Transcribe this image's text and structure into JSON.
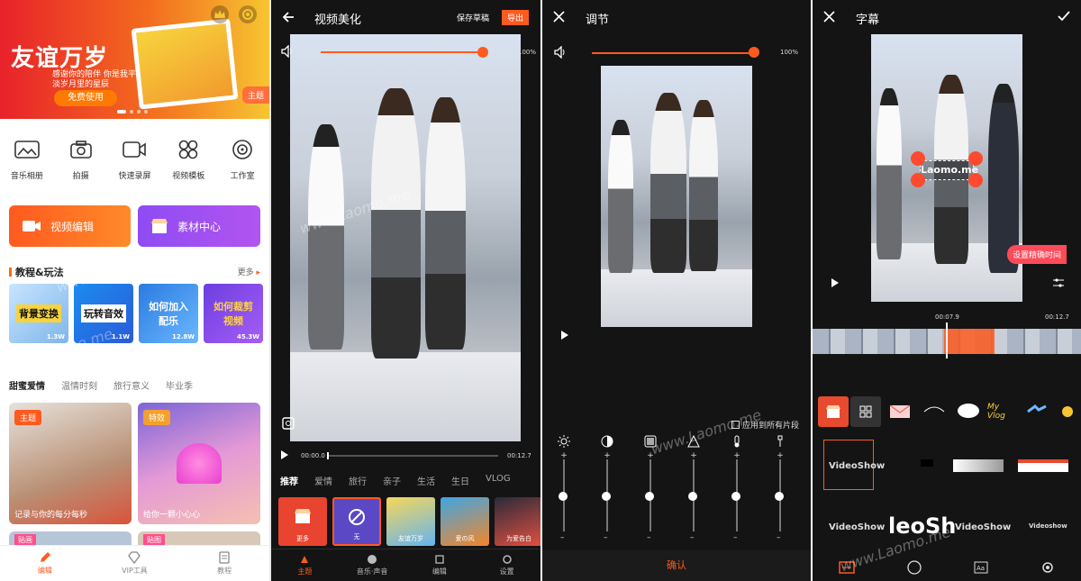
{
  "p1": {
    "banner": {
      "title": "友谊万岁",
      "sub": "感谢你的陪伴 你是我平淡岁月里的星辰",
      "btn": "免费使用",
      "tag": "主题"
    },
    "quick": [
      {
        "label": "音乐相册",
        "icon": "photo-album-icon"
      },
      {
        "label": "拍摄",
        "icon": "camera-icon"
      },
      {
        "label": "快速录屏",
        "icon": "screen-record-icon"
      },
      {
        "label": "视频模板",
        "icon": "template-icon"
      },
      {
        "label": "工作室",
        "icon": "studio-icon"
      }
    ],
    "btn_edit": "视频编辑",
    "btn_material": "素材中心",
    "section": "教程&玩法",
    "more": "更多",
    "tutorials": [
      {
        "text": "背景变换",
        "count": "1.3W"
      },
      {
        "text": "玩转音效",
        "count": "1.1W"
      },
      {
        "text": "如何加入配乐",
        "count": "12.8W"
      },
      {
        "text": "如何裁剪视频",
        "count": "45.3W"
      }
    ],
    "cats": [
      "甜蜜爱情",
      "温情时刻",
      "旅行意义",
      "毕业季"
    ],
    "cards": [
      {
        "badge": "主题",
        "caption": "记录与你的每分每秒"
      },
      {
        "badge": "特效",
        "caption": "给你一颗小心心"
      }
    ],
    "cards2": [
      {
        "badge": "贴画"
      },
      {
        "badge": "贴图"
      }
    ],
    "tabs": [
      {
        "label": "编辑"
      },
      {
        "label": "VIP工具"
      },
      {
        "label": "教程"
      }
    ],
    "colors": {
      "accent": "#ff5a1f"
    }
  },
  "p2": {
    "title": "视频美化",
    "save": "保存草稿",
    "export": "导出",
    "volume": "100%",
    "t_start": "00:00.0",
    "t_end": "00:12.7",
    "tabs": [
      "推荐",
      "爱情",
      "旅行",
      "亲子",
      "生活",
      "生日",
      "VLOG"
    ],
    "themes": [
      {
        "label": "更多"
      },
      {
        "label": "无"
      },
      {
        "label": "友谊万岁"
      },
      {
        "label": "爱の风"
      },
      {
        "label": "为爱告白"
      }
    ],
    "bottom": [
      {
        "label": "主题"
      },
      {
        "label": "音乐·声音"
      },
      {
        "label": "编辑"
      },
      {
        "label": "设置"
      }
    ]
  },
  "p3": {
    "title": "调节",
    "volume": "100%",
    "apply_all": "应用到所有片段",
    "confirm": "确认",
    "sliders": [
      {
        "icon": "brightness-icon",
        "level": 0.5
      },
      {
        "icon": "contrast-icon",
        "level": 0.5
      },
      {
        "icon": "saturation-icon",
        "level": 0.5
      },
      {
        "icon": "sharpen-icon",
        "level": 0.5
      },
      {
        "icon": "temperature-icon",
        "level": 0.5
      },
      {
        "icon": "vignette-icon",
        "level": 0.5
      }
    ]
  },
  "p4": {
    "title": "字幕",
    "subtitle_text": "Laomo.me",
    "precise": "设置精确时间",
    "t_mid": "00:07.9",
    "t_end": "00:12.7",
    "fonts": [
      "VideoShow",
      "leoSh",
      "VideoShow",
      "Videoshow"
    ]
  },
  "watermark": "www.Laomo.me"
}
